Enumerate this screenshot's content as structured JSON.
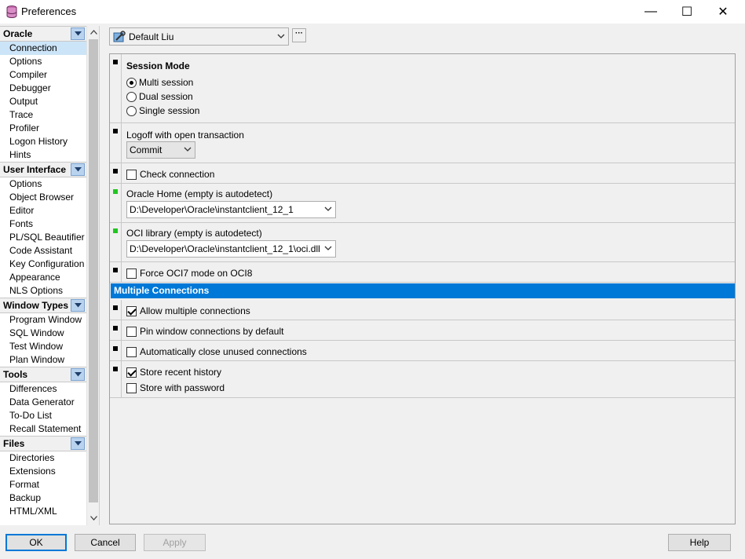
{
  "window": {
    "title": "Preferences",
    "minimize_glyph": "—",
    "maximize_glyph": "☐",
    "close_glyph": "✕"
  },
  "colors": {
    "accent": "#0078d7",
    "selection": "#cce4f7",
    "marker_green": "#22c522"
  },
  "nav": {
    "groups": [
      {
        "title": "Oracle",
        "items": [
          "Connection",
          "Options",
          "Compiler",
          "Debugger",
          "Output",
          "Trace",
          "Profiler",
          "Logon History",
          "Hints"
        ]
      },
      {
        "title": "User Interface",
        "items": [
          "Options",
          "Object Browser",
          "Editor",
          "Fonts",
          "PL/SQL Beautifier",
          "Code Assistant",
          "Key Configuration",
          "Appearance",
          "NLS Options"
        ]
      },
      {
        "title": "Window Types",
        "items": [
          "Program Window",
          "SQL Window",
          "Test Window",
          "Plan Window"
        ]
      },
      {
        "title": "Tools",
        "items": [
          "Differences",
          "Data Generator",
          "To-Do List",
          "Recall Statement"
        ]
      },
      {
        "title": "Files",
        "items": [
          "Directories",
          "Extensions",
          "Format",
          "Backup",
          "HTML/XML"
        ]
      }
    ],
    "selected": "Connection"
  },
  "profile": {
    "value": "Default Liu",
    "more_label": "···"
  },
  "connection": {
    "session_mode": {
      "title": "Session Mode",
      "options": [
        "Multi session",
        "Dual session",
        "Single session"
      ],
      "selected": "Multi session"
    },
    "logoff": {
      "label": "Logoff with open transaction",
      "value": "Commit"
    },
    "check_connection": {
      "label": "Check connection",
      "checked": false
    },
    "oracle_home": {
      "label": "Oracle Home (empty is autodetect)",
      "value": "D:\\Developer\\Oracle\\instantclient_12_1"
    },
    "oci_library": {
      "label": "OCI library (empty is autodetect)",
      "value": "D:\\Developer\\Oracle\\instantclient_12_1\\oci.dll"
    },
    "force_oci7": {
      "label": "Force OCI7 mode on OCI8",
      "checked": false
    }
  },
  "multiple_connections": {
    "header": "Multiple Connections",
    "allow_multiple": {
      "label": "Allow multiple connections",
      "checked": true
    },
    "pin_window": {
      "label": "Pin window connections by default",
      "checked": false
    },
    "auto_close": {
      "label": "Automatically close unused connections",
      "checked": false
    },
    "store_history": {
      "label": "Store recent history",
      "checked": true
    },
    "store_password": {
      "label": "Store with password",
      "checked": false
    }
  },
  "buttons": {
    "ok": "OK",
    "cancel": "Cancel",
    "apply": "Apply",
    "help": "Help"
  }
}
